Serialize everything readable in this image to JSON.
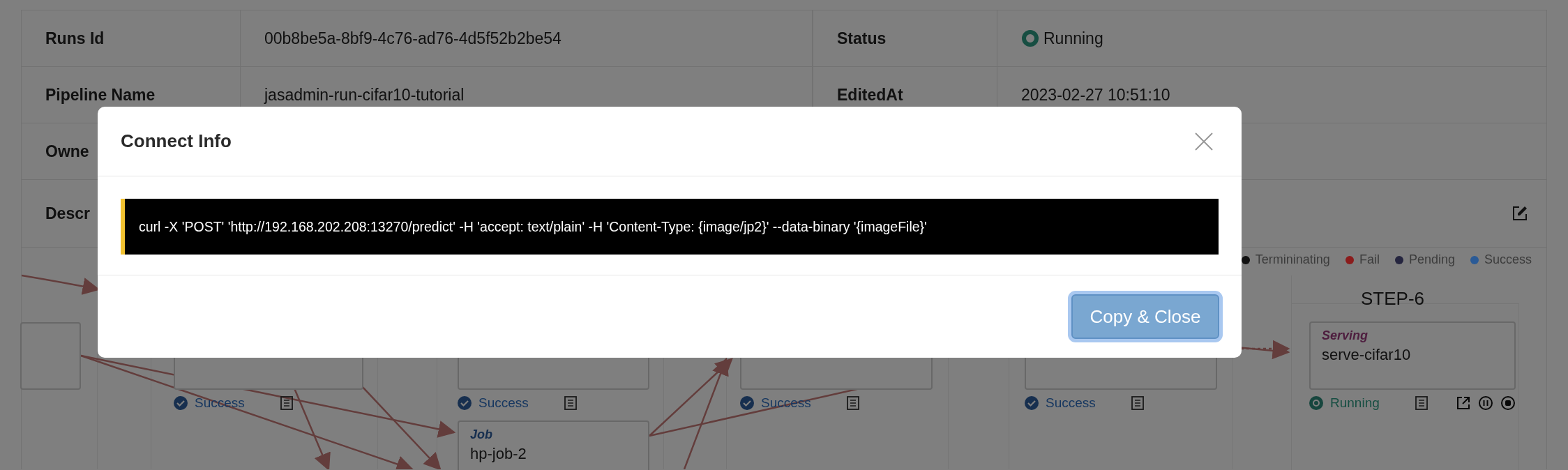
{
  "details": {
    "rows": [
      {
        "cells": [
          {
            "label": "Runs Id",
            "value": "00b8be5a-8bf9-4c76-ad76-4d5f52b2be54"
          },
          {
            "label": "Status",
            "value": "Running",
            "kind": "status"
          }
        ]
      },
      {
        "cells": [
          {
            "label": "Pipeline Name",
            "value": "jasadmin-run-cifar10-tutorial"
          },
          {
            "label": "EditedAt",
            "value": "2023-02-27 10:51:10"
          }
        ]
      },
      {
        "cells": [
          {
            "label": "Owne"
          }
        ]
      },
      {
        "cells": [
          {
            "label": "Descr"
          }
        ],
        "editable": true
      }
    ]
  },
  "pipeline": {
    "legend": [
      {
        "label": "Termininating",
        "color": "#111111"
      },
      {
        "label": "Fail",
        "color": "#8b1c1c"
      },
      {
        "label": "Pending",
        "color": "#25253f"
      },
      {
        "label": "Success",
        "color": "#2a5a96"
      }
    ],
    "step_label": "STEP-6",
    "nodes": [
      {
        "kind": "plain"
      },
      {
        "kind": "plain",
        "status": {
          "kind": "success",
          "label": "Success"
        }
      },
      {
        "kind": "plain",
        "status": {
          "kind": "success",
          "label": "Success"
        }
      },
      {
        "kind": "plain",
        "status": {
          "kind": "success",
          "label": "Success"
        }
      },
      {
        "kind": "plain",
        "status": {
          "kind": "success",
          "label": "Success"
        }
      },
      {
        "kind": "serving",
        "type": "Serving",
        "name": "serve-cifar10",
        "status": {
          "kind": "running",
          "label": "Running"
        },
        "actions": true
      },
      {
        "kind": "job",
        "type": "Job",
        "name": "hp-job-2"
      }
    ]
  },
  "dialog": {
    "title": "Connect Info",
    "command": "curl -X 'POST' 'http://192.168.202.208:13270/predict' -H 'accept: text/plain' -H 'Content-Type: {image/jp2}' --data-binary '{imageFile}'",
    "button": "Copy & Close"
  }
}
